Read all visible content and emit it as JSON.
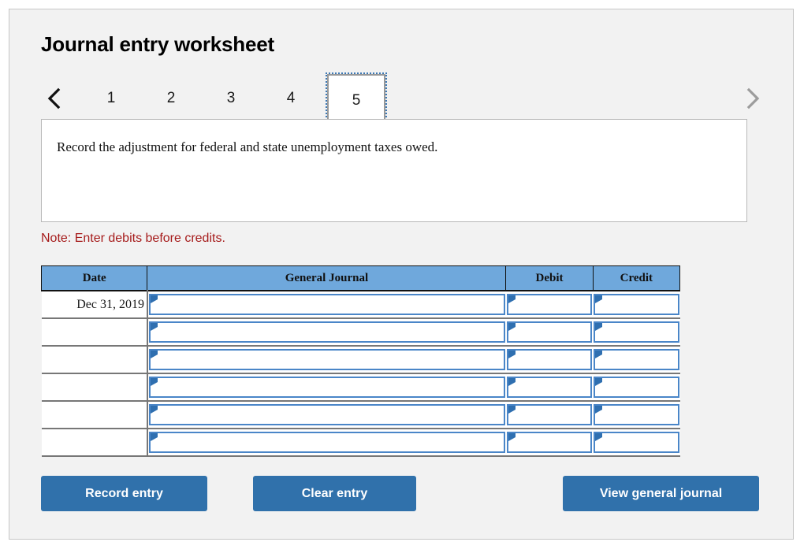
{
  "page": {
    "title": "Journal entry worksheet"
  },
  "pager": {
    "prev_icon": "chevron-left-icon",
    "next_icon": "chevron-right-icon",
    "tabs": [
      {
        "label": "1",
        "active": false
      },
      {
        "label": "2",
        "active": false
      },
      {
        "label": "3",
        "active": false
      },
      {
        "label": "4",
        "active": false
      },
      {
        "label": "5",
        "active": true
      }
    ],
    "active_tab": "5"
  },
  "instruction": {
    "text": "Record the adjustment for federal and state unemployment taxes owed."
  },
  "note": {
    "text": "Note: Enter debits before credits."
  },
  "journal": {
    "headers": {
      "date": "Date",
      "general_journal": "General Journal",
      "debit": "Debit",
      "credit": "Credit"
    },
    "rows": [
      {
        "date": "Dec 31, 2019",
        "account": "",
        "debit": "",
        "credit": ""
      },
      {
        "date": "",
        "account": "",
        "debit": "",
        "credit": ""
      },
      {
        "date": "",
        "account": "",
        "debit": "",
        "credit": ""
      },
      {
        "date": "",
        "account": "",
        "debit": "",
        "credit": ""
      },
      {
        "date": "",
        "account": "",
        "debit": "",
        "credit": ""
      },
      {
        "date": "",
        "account": "",
        "debit": "",
        "credit": ""
      }
    ]
  },
  "buttons": {
    "record": "Record entry",
    "clear": "Clear entry",
    "view": "View general journal"
  },
  "colors": {
    "header_blue": "#6fa8dc",
    "button_blue": "#3071ab",
    "note_red": "#a61c1c",
    "panel_bg": "#f2f2f2",
    "field_border": "#4a86c8"
  }
}
